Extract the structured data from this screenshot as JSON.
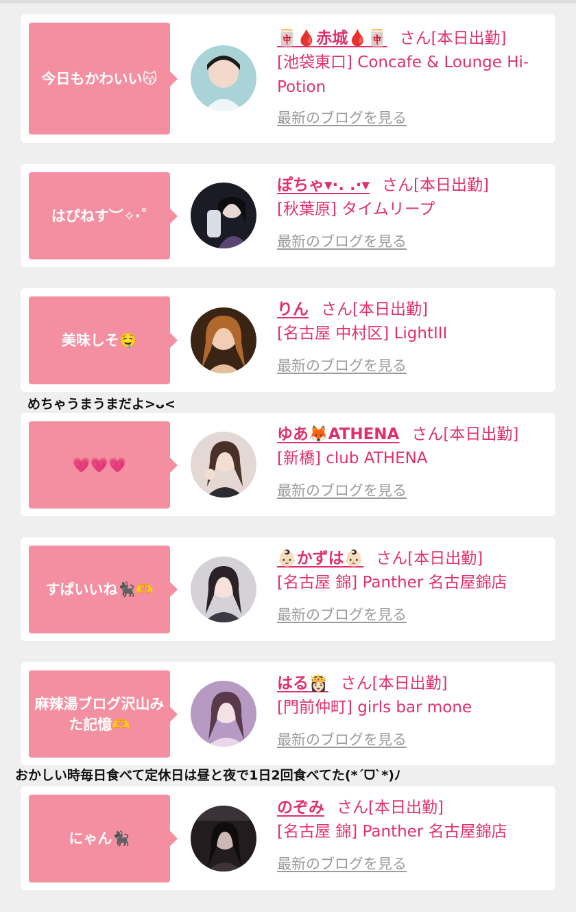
{
  "suffix_san": "さん",
  "duty_status": "[本日出勤]",
  "blog_link_label": "最新のブログを見る",
  "cards": [
    {
      "comment": "今日もかわいい😽",
      "name": "🀄🩸赤城🩸🀄",
      "shop": "[池袋東口] Concafe & Lounge Hi-Potion"
    },
    {
      "comment": "はぴねす︶✧‧˚",
      "name": "ぽちゃ▾·. .·▾",
      "shop": "[秋葉原] タイムリープ"
    },
    {
      "comment": "美味しそ🤤",
      "name": "りん",
      "shop": "[名古屋 中村区] LightIII"
    },
    {
      "comment": "💗💗💗",
      "name": "ゆあ🦊ATHENA",
      "shop": "[新橋] club ATHENA"
    },
    {
      "comment": "すぱいいね🐈‍⬛🫶",
      "name": "👶🏻かずは👶🏻",
      "shop": "[名古屋 錦] Panther 名古屋錦店"
    },
    {
      "comment": "麻辣湯ブログ沢山みた記憶🫶",
      "name": "はる👸🏻",
      "shop": "[門前仲町] girls bar mone"
    },
    {
      "comment": "にゃん🐈‍⬛",
      "name": "のぞみ",
      "shop": "[名古屋 錦] Panther 名古屋錦店"
    }
  ],
  "captions": [
    "めちゃうまうまだよ>ᴗ<",
    "おかしい時毎日食べて定休日は昼と夜で1日2回食べてた(*´ᗜ`*)ﾉ"
  ],
  "avatar_colors": [
    "#a9d3d6",
    "#1a1b24",
    "#6b3a1c",
    "#d9c8c3",
    "#c8c8cc",
    "#9a76a4",
    "#2a2426"
  ]
}
